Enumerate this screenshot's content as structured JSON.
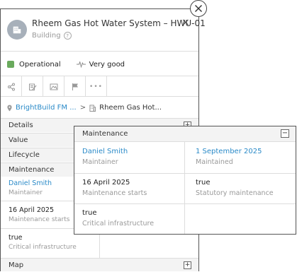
{
  "header": {
    "title": "Rheem Gas Hot Water System – HWU-01",
    "subtitle": "Building",
    "close": "×"
  },
  "status": {
    "primary": "Operational",
    "secondary": "Very good",
    "primary_color": "#6aaa5d"
  },
  "toolbar": {
    "items": [
      "share-icon",
      "edit-icon",
      "image-icon",
      "flag-icon",
      "more-icon"
    ],
    "more_label": "•••"
  },
  "breadcrumb": {
    "first": "BrightBuild FM ...",
    "separator": ">",
    "current": "Rheem Gas Hot..."
  },
  "sections": {
    "details": "Details",
    "value": "Value",
    "lifecycle": "Lifecycle",
    "maintenance": "Maintenance",
    "map": "Map",
    "expand": "+",
    "collapse": "−"
  },
  "maintenance": {
    "title": "Maintenance",
    "maintainer_value": "Daniel Smith",
    "maintainer_label": "Maintainer",
    "maintained_value": "1 September 2025",
    "maintained_label": "Maintained",
    "starts_value": "16 April 2025",
    "starts_label": "Maintenance starts",
    "statutory_value": "true",
    "statutory_label": "Statutory maintenance",
    "critical_value": "true",
    "critical_label": "Critical infrastructure"
  },
  "colors": {
    "link": "#2a8ac8",
    "border": "#555555"
  }
}
